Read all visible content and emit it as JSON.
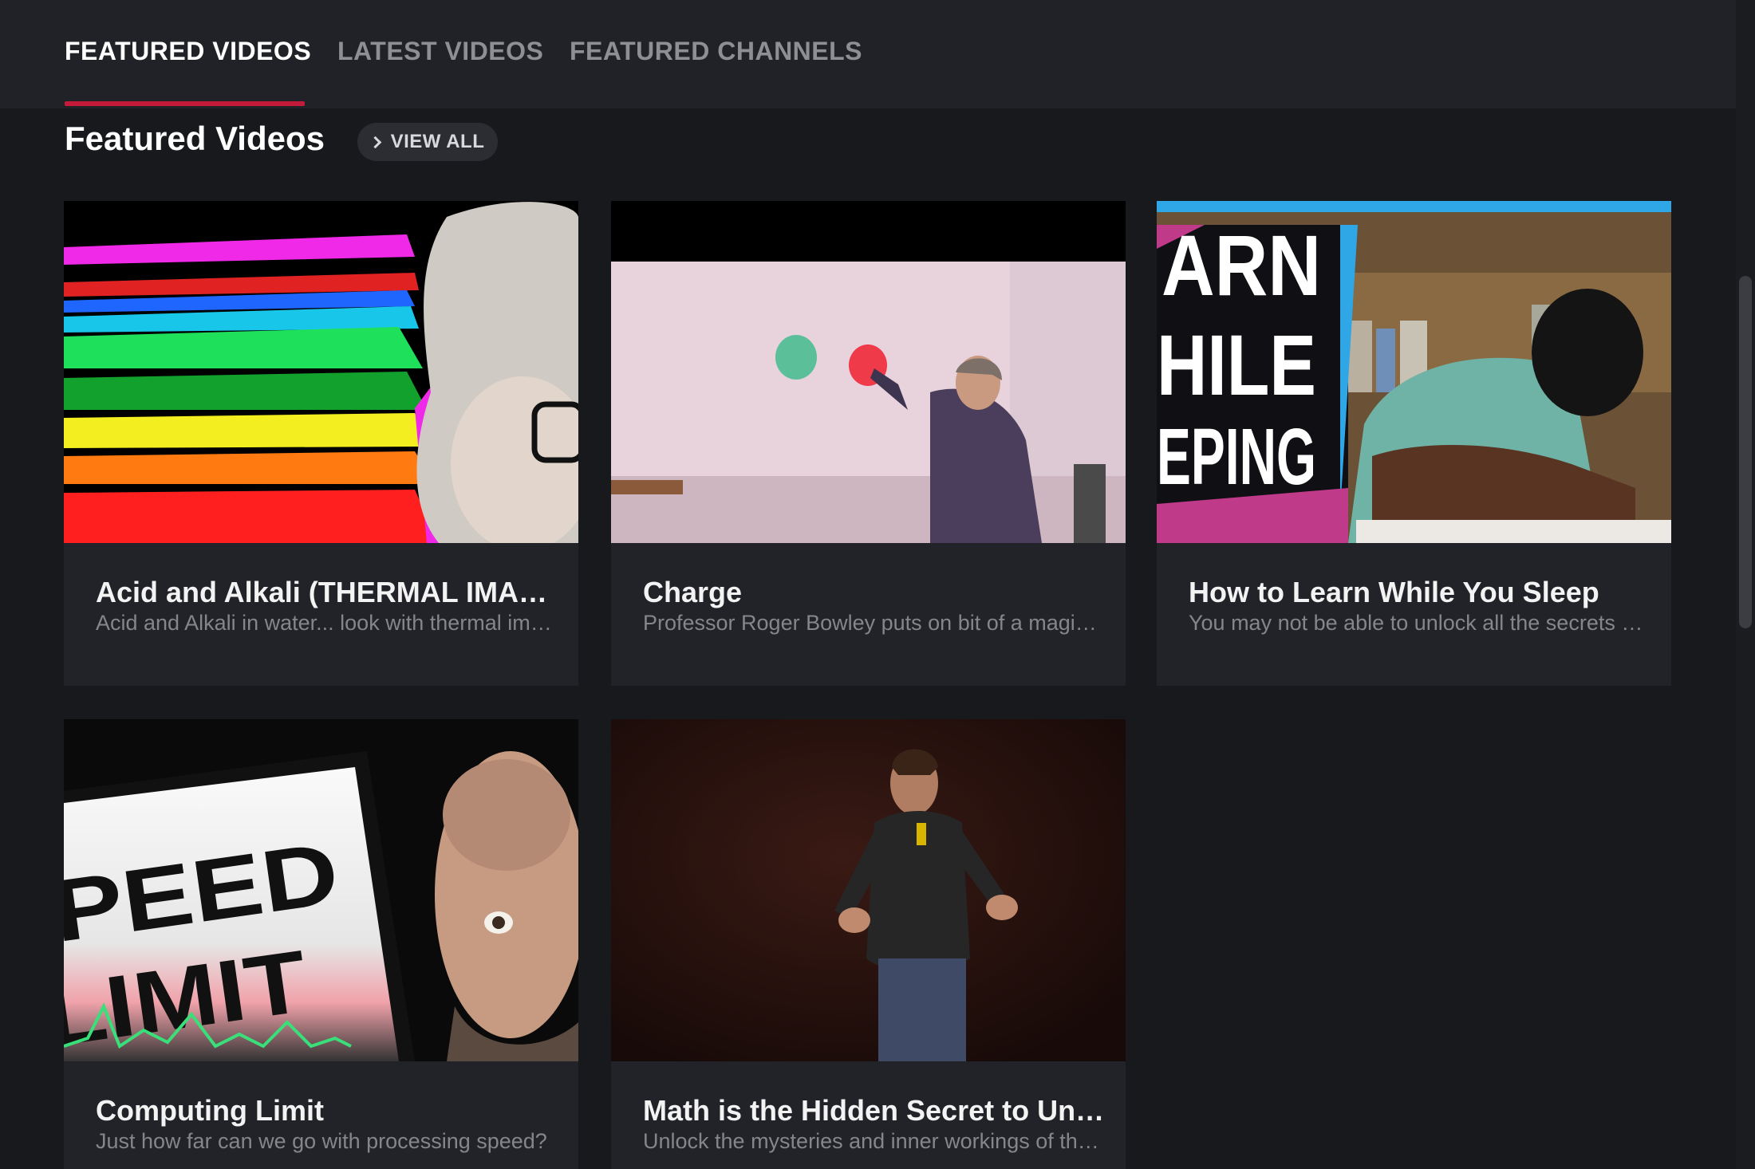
{
  "tabs": [
    {
      "label": "FEATURED VIDEOS",
      "active": true
    },
    {
      "label": "LATEST VIDEOS",
      "active": false
    },
    {
      "label": "FEATURED CHANNELS",
      "active": false
    }
  ],
  "section": {
    "title": "Featured Videos",
    "view_all_label": "VIEW ALL"
  },
  "videos": [
    {
      "title": "Acid and Alkali (THERMAL IMAGING)",
      "description": "Acid and Alkali in water... look with thermal imaging camera",
      "thumbnail": "thermal-imaging-thumbnail",
      "thumbnail_text": ""
    },
    {
      "title": "Charge",
      "description": "Professor Roger Bowley puts on bit of a magic show with balloons",
      "thumbnail": "balloons-lecture-thumbnail",
      "thumbnail_text": ""
    },
    {
      "title": "How to Learn While You Sleep",
      "description": "You may not be able to unlock all the secrets of sleep learning",
      "thumbnail": "sleeping-student-thumbnail",
      "thumbnail_text": [
        "ARN",
        "HILE",
        "EPING"
      ]
    },
    {
      "title": "Computing Limit",
      "description": "Just how far can we go with processing speed?",
      "thumbnail": "speed-limit-thumbnail",
      "thumbnail_text": [
        "PEED",
        "LIMIT"
      ]
    },
    {
      "title": "Math is the Hidden Secret to Understanding the World",
      "description": "Unlock the mysteries and inner workings of the world",
      "thumbnail": "stage-speaker-thumbnail",
      "thumbnail_text": ""
    }
  ],
  "colors": {
    "accent": "#c41b3b",
    "background": "#18191d",
    "card": "#222328"
  }
}
